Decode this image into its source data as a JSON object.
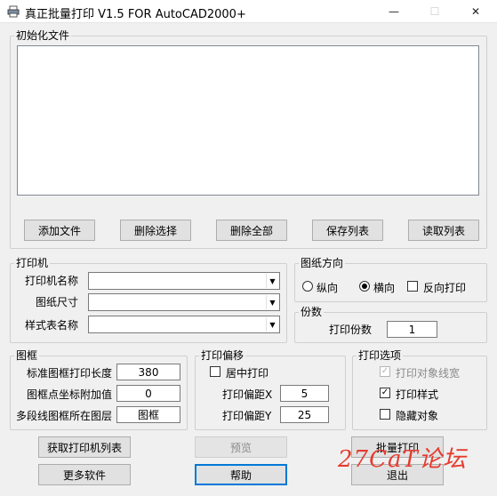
{
  "window": {
    "title": "真正批量打印 V1.5 FOR AutoCAD2000+",
    "minimize": "—",
    "maximize": "☐",
    "close": "✕"
  },
  "init_file": {
    "legend": "初始化文件",
    "buttons": [
      "添加文件",
      "删除选择",
      "删除全部",
      "保存列表",
      "读取列表"
    ]
  },
  "printer": {
    "legend": "打印机",
    "name_label": "打印机名称",
    "paper_label": "图纸尺寸",
    "style_label": "样式表名称"
  },
  "orientation": {
    "legend": "图纸方向",
    "portrait": "纵向",
    "landscape": "横向",
    "landscape_selected": true,
    "reverse": "反向打印",
    "reverse_checked": false
  },
  "copies": {
    "legend": "份数",
    "label": "打印份数",
    "value": "1"
  },
  "frame": {
    "legend": "图框",
    "length_label": "标准图框打印长度",
    "length_value": "380",
    "coord_label": "图框点坐标附加值",
    "coord_value": "0",
    "layer_label": "多段线图框所在图层",
    "layer_value": "图框"
  },
  "offset": {
    "legend": "打印偏移",
    "center_label": "居中打印",
    "center_checked": false,
    "x_label": "打印偏距X",
    "x_value": "5",
    "y_label": "打印偏距Y",
    "y_value": "25"
  },
  "options": {
    "legend": "打印选项",
    "lineweight_label": "打印对象线宽",
    "lineweight_checked": true,
    "style_label": "打印样式",
    "style_checked": true,
    "hidden_label": "隐藏对象",
    "hidden_checked": false
  },
  "footer": {
    "get_printers": "获取打印机列表",
    "preview": "预览",
    "batch_print": "批量打印",
    "more_software": "更多软件",
    "help": "帮助",
    "exit": "退出"
  },
  "watermark": "27CaT论坛",
  "icons": {
    "app": "printer-icon",
    "check": "✓",
    "dropdown": "▼"
  }
}
